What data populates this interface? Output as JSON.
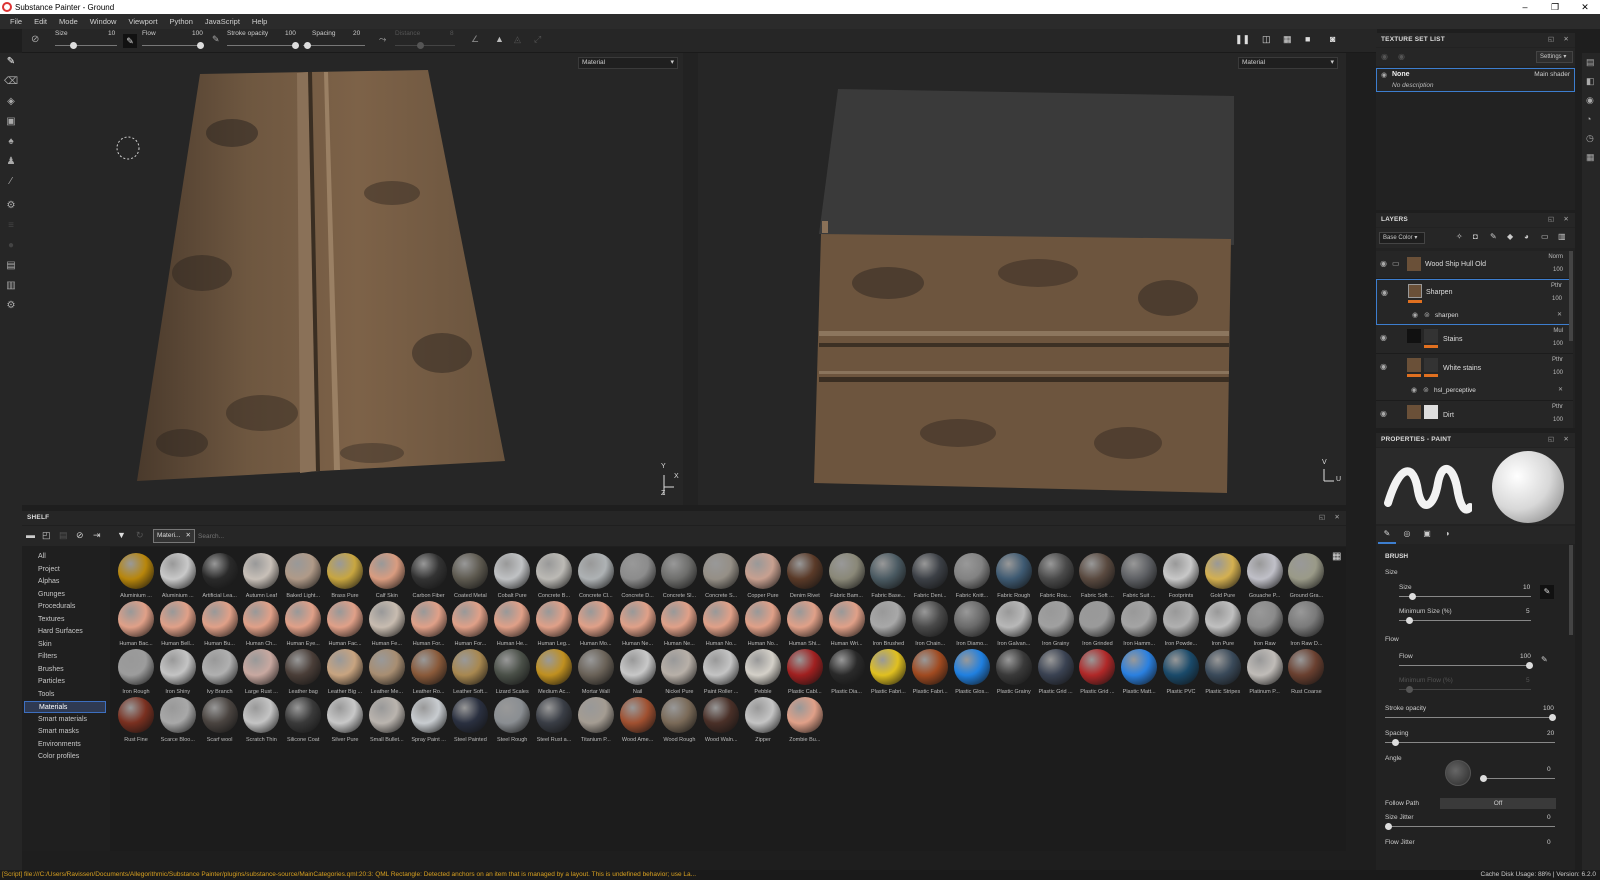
{
  "window": {
    "title": "Substance Painter - Ground"
  },
  "menu": [
    "File",
    "Edit",
    "Mode",
    "Window",
    "Viewport",
    "Python",
    "JavaScript",
    "Help"
  ],
  "toolbar": {
    "size_label": "Size",
    "size_value": "10",
    "flow_label": "Flow",
    "flow_value": "100",
    "stroke_label": "Stroke opacity",
    "stroke_value": "100",
    "spacing_label": "Spacing",
    "spacing_value": "20",
    "distance_label": "Distance",
    "distance_value": "8"
  },
  "viewport3d": {
    "mode": "Material",
    "axis_y": "Y",
    "axis_x": "X",
    "axis_z": "Z"
  },
  "viewport2d": {
    "mode": "Material",
    "axis_v": "V",
    "axis_u": "U"
  },
  "texture_set": {
    "title": "TEXTURE SET LIST",
    "settings": "Settings",
    "item_name": "None",
    "item_shader": "Main shader",
    "item_desc": "No description"
  },
  "layers": {
    "title": "LAYERS",
    "channel": "Base Color",
    "rows": [
      {
        "name": "Wood Ship Hull Old",
        "blend": "Norm",
        "opacity": "100"
      },
      {
        "name": "Sharpen",
        "blend": "Pthr",
        "opacity": "100"
      },
      {
        "name": "sharpen"
      },
      {
        "name": "Stains",
        "blend": "Mul",
        "opacity": "100"
      },
      {
        "name": "White stains",
        "blend": "Pthr",
        "opacity": "100"
      },
      {
        "name": "hsl_perceptive"
      },
      {
        "name": "Dirt",
        "blend": "Pthr",
        "opacity": "100"
      }
    ]
  },
  "properties": {
    "title": "PROPERTIES - PAINT",
    "brush_heading": "BRUSH",
    "size_group": "Size",
    "size_label": "Size",
    "size_value": "10",
    "min_size_label": "Minimum Size (%)",
    "min_size_value": "5",
    "flow_group": "Flow",
    "flow_label": "Flow",
    "flow_value": "100",
    "min_flow_label": "Minimum Flow (%)",
    "min_flow_value": "5",
    "stroke_label": "Stroke opacity",
    "stroke_value": "100",
    "spacing_label": "Spacing",
    "spacing_value": "20",
    "angle_label": "Angle",
    "angle_value": "0",
    "follow_label": "Follow Path",
    "follow_value": "Off",
    "size_jitter_label": "Size Jitter",
    "size_jitter_value": "0",
    "flow_jitter_label": "Flow Jitter",
    "flow_jitter_value": "0"
  },
  "shelf": {
    "title": "SHELF",
    "filter_tag": "Materi...",
    "search_placeholder": "Search...",
    "selected_category": "Materials",
    "categories": [
      "All",
      "Project",
      "Alphas",
      "Grunges",
      "Procedurals",
      "Textures",
      "Hard Surfaces",
      "Skin",
      "Filters",
      "Brushes",
      "Particles",
      "Tools",
      "Materials",
      "Smart materials",
      "Smart masks",
      "Environments",
      "Color profiles"
    ],
    "materials": [
      {
        "name": "Aluminium ...",
        "color": "#b8860b"
      },
      {
        "name": "Aluminium ...",
        "color": "#c9c9c9"
      },
      {
        "name": "Artificial Lea...",
        "color": "#2a2a2a"
      },
      {
        "name": "Autumn Leaf",
        "color": "#c8c0b8"
      },
      {
        "name": "Baked Light...",
        "color": "#b09a88"
      },
      {
        "name": "Brass Pure",
        "color": "#c8a640"
      },
      {
        "name": "Calf Skin",
        "color": "#d99c80"
      },
      {
        "name": "Carbon Fiber",
        "color": "#333333"
      },
      {
        "name": "Coated Metal",
        "color": "#5e5a50"
      },
      {
        "name": "Cobalt Pure",
        "color": "#c0c2c4"
      },
      {
        "name": "Concrete B...",
        "color": "#bcbab5"
      },
      {
        "name": "Concrete Cl...",
        "color": "#aeb2b4"
      },
      {
        "name": "Concrete D...",
        "color": "#8c8c8c"
      },
      {
        "name": "Concrete Sl...",
        "color": "#6e6e6c"
      },
      {
        "name": "Concrete S...",
        "color": "#958f86"
      },
      {
        "name": "Copper Pure",
        "color": "#c8a090"
      },
      {
        "name": "Denim Rivet",
        "color": "#5a3a28"
      },
      {
        "name": "Fabric Bam...",
        "color": "#8a8878"
      },
      {
        "name": "Fabric Base...",
        "color": "#4a5a62"
      },
      {
        "name": "Fabric Deni...",
        "color": "#3c4046"
      },
      {
        "name": "Fabric Knitt...",
        "color": "#828282"
      },
      {
        "name": "Fabric Rough",
        "color": "#3e5a72"
      },
      {
        "name": "Fabric Rou...",
        "color": "#4a4a4a"
      },
      {
        "name": "Fabric Soft ...",
        "color": "#5a4a40"
      },
      {
        "name": "Fabric Suit ...",
        "color": "#5e6064"
      },
      {
        "name": "Footprints",
        "color": "#c8c8c8"
      },
      {
        "name": "Gold Pure",
        "color": "#d4b050"
      },
      {
        "name": "Gouache P...",
        "color": "#c0c0c8"
      },
      {
        "name": "Ground Gra...",
        "color": "#9a9a88"
      },
      {
        "name": "Human Bac...",
        "color": "#e0a088"
      },
      {
        "name": "Human Bell...",
        "color": "#e0a088"
      },
      {
        "name": "Human Bu...",
        "color": "#e0a088"
      },
      {
        "name": "Human Ch...",
        "color": "#e0a088"
      },
      {
        "name": "Human Eye...",
        "color": "#e0a088"
      },
      {
        "name": "Human Fac...",
        "color": "#e0a088"
      },
      {
        "name": "Human Fe...",
        "color": "#c8bcb0"
      },
      {
        "name": "Human For...",
        "color": "#e0a088"
      },
      {
        "name": "Human For...",
        "color": "#e0a088"
      },
      {
        "name": "Human He...",
        "color": "#e0a088"
      },
      {
        "name": "Human Leg...",
        "color": "#e0a088"
      },
      {
        "name": "Human Mo...",
        "color": "#e0a088"
      },
      {
        "name": "Human Ne...",
        "color": "#e0a088"
      },
      {
        "name": "Human Ne...",
        "color": "#e0a088"
      },
      {
        "name": "Human No...",
        "color": "#e0a088"
      },
      {
        "name": "Human No...",
        "color": "#e0a088"
      },
      {
        "name": "Human Shi...",
        "color": "#e0a088"
      },
      {
        "name": "Human Wri...",
        "color": "#e0a088"
      },
      {
        "name": "Iron Brushed",
        "color": "#a8a8a8"
      },
      {
        "name": "Iron Chain...",
        "color": "#4a4a4a"
      },
      {
        "name": "Iron Diamo...",
        "color": "#6a6a6a"
      },
      {
        "name": "Iron Galvan...",
        "color": "#b8b8b8"
      },
      {
        "name": "Iron Grainy",
        "color": "#a0a0a0"
      },
      {
        "name": "Iron Grinded",
        "color": "#9a9a9a"
      },
      {
        "name": "Iron Hamm...",
        "color": "#a4a4a4"
      },
      {
        "name": "Iron Powde...",
        "color": "#b0b0b0"
      },
      {
        "name": "Iron Pure",
        "color": "#c0c0c0"
      },
      {
        "name": "Iron Raw",
        "color": "#8a8a8a"
      },
      {
        "name": "Iron Raw D...",
        "color": "#7a7a7a"
      },
      {
        "name": "Iron Rough",
        "color": "#9c9c9c"
      },
      {
        "name": "Iron Shiny",
        "color": "#c4c4c4"
      },
      {
        "name": "Ivy Branch",
        "color": "#b0b0b0"
      },
      {
        "name": "Large Rust ...",
        "color": "#c8a8a0"
      },
      {
        "name": "Leather bag",
        "color": "#4a3e38"
      },
      {
        "name": "Leather Big ...",
        "color": "#c8a480"
      },
      {
        "name": "Leather Me...",
        "color": "#a88e72"
      },
      {
        "name": "Leather Ro...",
        "color": "#8a5a3a"
      },
      {
        "name": "Leather Soft...",
        "color": "#a88850"
      },
      {
        "name": "Lizard Scales",
        "color": "#4a5048"
      },
      {
        "name": "Medium Ac...",
        "color": "#c09020"
      },
      {
        "name": "Mortar Wall",
        "color": "#6a6258"
      },
      {
        "name": "Nail",
        "color": "#c8c8c8"
      },
      {
        "name": "Nickel Pure",
        "color": "#b8b0a8"
      },
      {
        "name": "Paint Roller ...",
        "color": "#c4c4c4"
      },
      {
        "name": "Pebble",
        "color": "#d4d0c8"
      },
      {
        "name": "Plastic Cabl...",
        "color": "#a02020"
      },
      {
        "name": "Plastic Dia...",
        "color": "#2a2a2a"
      },
      {
        "name": "Plastic Fabri...",
        "color": "#e0c020"
      },
      {
        "name": "Plastic Fabri...",
        "color": "#a04a20"
      },
      {
        "name": "Plastic Glos...",
        "color": "#2080e0"
      },
      {
        "name": "Plastic Grainy",
        "color": "#3a3a3a"
      },
      {
        "name": "Plastic Grid ...",
        "color": "#3a4252"
      },
      {
        "name": "Plastic Grid ...",
        "color": "#b02828"
      },
      {
        "name": "Plastic Matt...",
        "color": "#2a80e0"
      },
      {
        "name": "Plastic PVC",
        "color": "#1a4a6a"
      },
      {
        "name": "Plastic Stripes",
        "color": "#3a4a5a"
      },
      {
        "name": "Platinum P...",
        "color": "#c0bcb8"
      },
      {
        "name": "Rust Coarse",
        "color": "#6a4030"
      },
      {
        "name": "Rust Fine",
        "color": "#7a3020"
      },
      {
        "name": "Scarce Bloo...",
        "color": "#a8a8a8"
      },
      {
        "name": "Scarf wool",
        "color": "#4a4440"
      },
      {
        "name": "Scratch Thin",
        "color": "#c4c4c4"
      },
      {
        "name": "Silicone Coat",
        "color": "#3a3a3a"
      },
      {
        "name": "Silver Pure",
        "color": "#c8c8c8"
      },
      {
        "name": "Small Bullet...",
        "color": "#bab4ae"
      },
      {
        "name": "Spray Paint ...",
        "color": "#c8ccd0"
      },
      {
        "name": "Steel Painted",
        "color": "#2a3040"
      },
      {
        "name": "Steel Rough",
        "color": "#8a8e92"
      },
      {
        "name": "Steel Rust a...",
        "color": "#3a3e46"
      },
      {
        "name": "Titanium P...",
        "color": "#a49c92"
      },
      {
        "name": "Wood Ame...",
        "color": "#a05030"
      },
      {
        "name": "Wood Rough",
        "color": "#7a6a58"
      },
      {
        "name": "Wood Waln...",
        "color": "#4a3028"
      },
      {
        "name": "Zipper",
        "color": "#c4c4c4"
      },
      {
        "name": "Zombie Bu...",
        "color": "#e0a088"
      }
    ]
  },
  "status": {
    "log": "[Script] file:///C:/Users/Ravissen/Documents/Allegorithmic/Substance Painter/plugins/substance-source/MainCategories.qml:20:3: QML Rectangle: Detected anchors on an item that is managed by a layout. This is undefined behavior; use La...",
    "cache": "Cache Disk Usage:    88%  |  Version: 6.2.0"
  }
}
